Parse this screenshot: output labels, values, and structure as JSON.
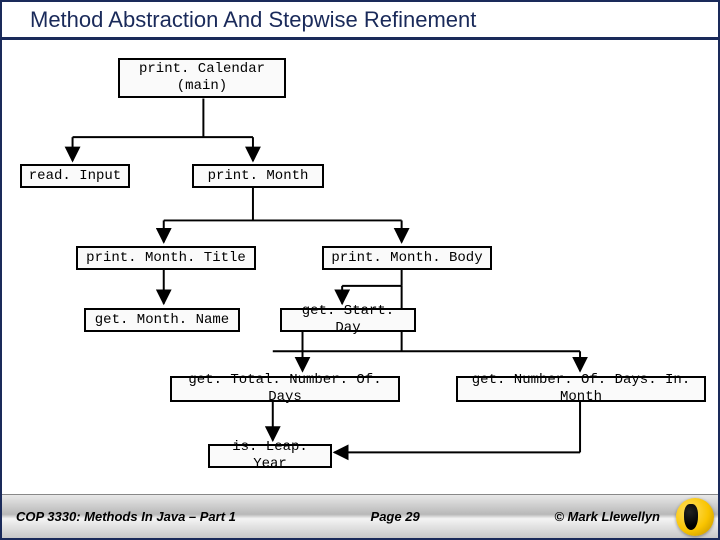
{
  "title": "Method Abstraction And Stepwise Refinement",
  "nodes": {
    "root": "print. Calendar\n(main)",
    "readInput": "read. Input",
    "printMonth": "print. Month",
    "printMonthTitle": "print. Month. Title",
    "printMonthBody": "print. Month. Body",
    "getMonthName": "get. Month. Name",
    "getStartDay": "get. Start. Day",
    "getTotalDays": "get. Total. Number. Of. Days",
    "getDaysInMonth": "get. Number. Of. Days. In. Month",
    "isLeapYear": "is. Leap. Year"
  },
  "footer": {
    "course": "COP 3330:  Methods In Java – Part 1",
    "page": "Page 29",
    "copyright": "© Mark Llewellyn"
  }
}
